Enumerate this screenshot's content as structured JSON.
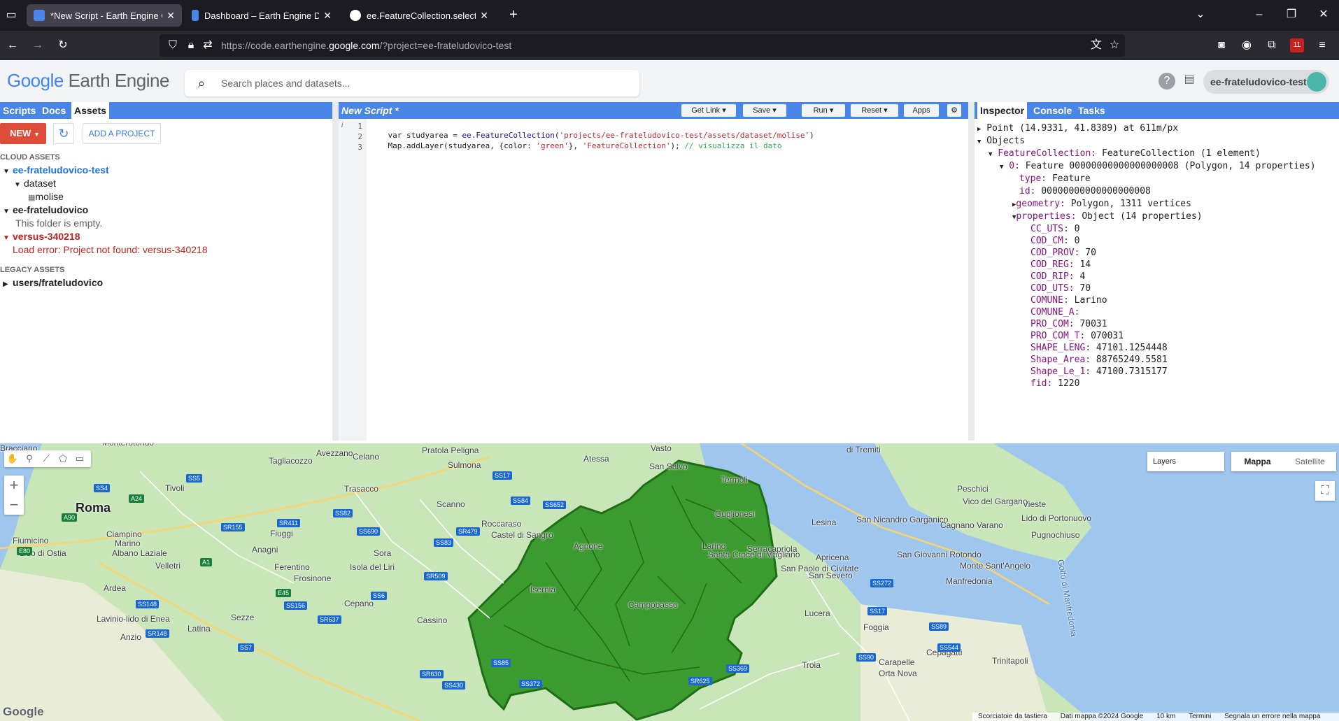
{
  "browser": {
    "tabs": [
      {
        "title": "*New Script - Earth Engine Code Editor",
        "active": true
      },
      {
        "title": "Dashboard – Earth Engine Default",
        "active": false
      },
      {
        "title": "ee.FeatureCollection.select | Google",
        "active": false
      }
    ],
    "url_host": "https://code.earthengine.",
    "url_domain": "google.com",
    "url_path": "/?project=ee-frateludovico-test"
  },
  "header": {
    "logo_google": "Google",
    "logo_product": "Earth Engine",
    "search_placeholder": "Search places and datasets...",
    "project": "ee-frateludovico-test"
  },
  "left_panel": {
    "tabs": [
      "Scripts",
      "Docs",
      "Assets"
    ],
    "new_label": "NEW",
    "add_project_label": "ADD A PROJECT",
    "cloud_assets_label": "CLOUD ASSETS",
    "projects": [
      {
        "name": "ee-frateludovico-test",
        "children": [
          {
            "name": "dataset",
            "children": [
              {
                "name": "molise"
              }
            ]
          }
        ]
      },
      {
        "name": "ee-frateludovico",
        "note": "This folder is empty."
      },
      {
        "name": "versus-340218",
        "error": "Load error: Project not found: versus-340218"
      }
    ],
    "legacy_assets_label": "LEGACY ASSETS",
    "legacy": "users/frateludovico"
  },
  "editor": {
    "title": "New Script *",
    "buttons": {
      "get_link": "Get Link",
      "save": "Save",
      "run": "Run",
      "reset": "Reset",
      "apps": "Apps"
    },
    "lines": [
      {
        "num": "1",
        "a": "var studyarea = ",
        "fn": "ee.FeatureCollection",
        "b": "(",
        "str": "'projects/ee-frateludovico-test/assets/dataset/molise'",
        "c": ")"
      },
      {
        "num": "2",
        "a": "Map.addLayer(studyarea, {color: ",
        "str1": "'green'",
        "b": "}, ",
        "str2": "'FeatureCollection'",
        "c": "); ",
        "cm": "// visualizza il dato"
      },
      {
        "num": "3"
      }
    ]
  },
  "right_panel": {
    "tabs": [
      "Inspector",
      "Console",
      "Tasks"
    ],
    "point": "Point (14.9331, 41.8389) at 611m/px",
    "objects": "Objects",
    "fc_key": "FeatureCollection:",
    "fc_val": "FeatureCollection (1 element)",
    "feat_key": "0:",
    "feat_val": "Feature 00000000000000000008 (Polygon, 14 properties)",
    "type_key": "type:",
    "type_val": "Feature",
    "id_key": "id:",
    "id_val": "00000000000000000008",
    "geom_key": "geometry:",
    "geom_val": "Polygon, 1311 vertices",
    "props_key": "properties:",
    "props_val": "Object (14 properties)",
    "properties": [
      {
        "k": "CC_UTS:",
        "v": "0"
      },
      {
        "k": "COD_CM:",
        "v": "0"
      },
      {
        "k": "COD_PROV:",
        "v": "70"
      },
      {
        "k": "COD_REG:",
        "v": "14"
      },
      {
        "k": "COD_RIP:",
        "v": "4"
      },
      {
        "k": "COD_UTS:",
        "v": "70"
      },
      {
        "k": "COMUNE:",
        "v": "Larino"
      },
      {
        "k": "COMUNE_A:",
        "v": ""
      },
      {
        "k": "PRO_COM:",
        "v": "70031"
      },
      {
        "k": "PRO_COM_T:",
        "v": "070031"
      },
      {
        "k": "SHAPE_LENG:",
        "v": "47101.1254448"
      },
      {
        "k": "Shape_Area:",
        "v": "88765249.5581"
      },
      {
        "k": "Shape_Le_1:",
        "v": "47100.7315177"
      },
      {
        "k": "fid:",
        "v": "1220"
      }
    ]
  },
  "map": {
    "layers_label": "Layers",
    "maptype": [
      "Mappa",
      "Satellite"
    ],
    "google": "Google",
    "attribution": [
      "Scorciatoie da tastiera",
      "Dati mappa ©2024 Google",
      "10 km",
      "Termini",
      "Segnala un errore nella mappa"
    ],
    "places": [
      "Bracciano",
      "Monterotondo",
      "Tagliacozzo",
      "Avezzano",
      "Celano",
      "Pratola Peligna",
      "Sulmona",
      "Atessa",
      "Vasto",
      "San Salvo",
      "Termoli",
      "Tivoli",
      "Trasacco",
      "Scanno",
      "Roma",
      "Fiumicino",
      "Ciampino",
      "Marino",
      "Albano Laziale",
      "Lido di Ostia",
      "Velletri",
      "Anagni",
      "Fiuggi",
      "Sora",
      "Ferentino",
      "Frosinone",
      "Isola del Liri",
      "Roccaraso",
      "Castel di Sangro",
      "Agnone",
      "Isernia",
      "Campobasso",
      "Larino",
      "Guglionesi",
      "Santa Croce di Magliano",
      "Serracapriola",
      "San Paolo di Civitate",
      "Lesina",
      "San Nicandro Garganico",
      "Cagnano Varano",
      "Apricena",
      "San Severo",
      "Peschici",
      "Vico del Gargano",
      "Vieste",
      "Lido di Portonuovo",
      "Pugnochiuso",
      "San Giovanni Rotondo",
      "Monte Sant'Angelo",
      "Manfredonia",
      "Golfo di Manfredonia",
      "Lucera",
      "Foggia",
      "Cepagatti",
      "Ardea",
      "Cepano",
      "Cassino",
      "Latina",
      "Lavinio-lido di Enea",
      "Anzio",
      "Sezze",
      "Troia",
      "Carapelle",
      "Orta Nova",
      "Trinitapoli",
      "di Tremiti"
    ],
    "roads": [
      "SS4",
      "SS5",
      "A24",
      "A90",
      "SR155",
      "SR411",
      "SS82",
      "SS690",
      "SR479",
      "SS83",
      "SS84",
      "SS17",
      "SS652",
      "SS6",
      "SR509",
      "SS156",
      "SR637",
      "SS148",
      "SS7",
      "SS85",
      "SR630",
      "SS372",
      "SS430",
      "SR625",
      "SS369",
      "SS544",
      "SS90",
      "SS89",
      "SS17",
      "SS272",
      "E80",
      "A1",
      "E45",
      "SR148"
    ]
  }
}
